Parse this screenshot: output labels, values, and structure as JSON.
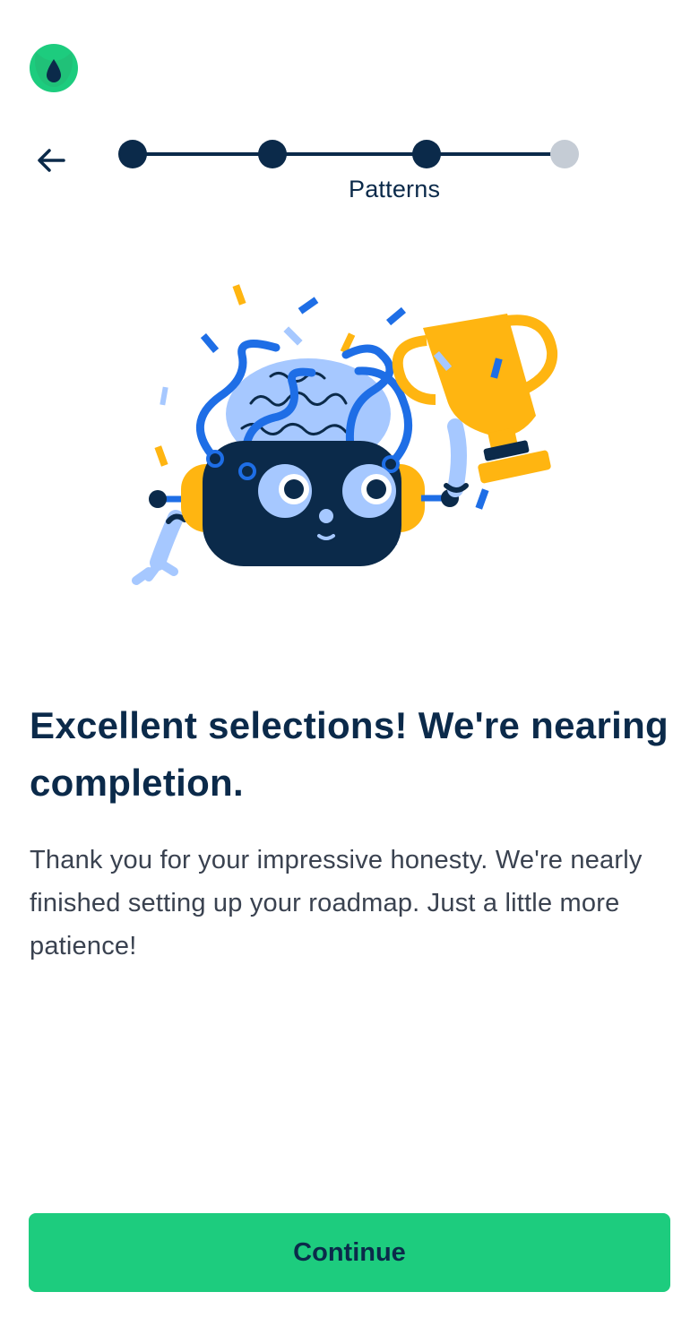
{
  "app": {
    "logo_icon": "app-logo-icon",
    "brand_color": "#1dcc7e"
  },
  "navigation": {
    "back_icon": "arrow-left-icon"
  },
  "progress": {
    "total_steps": 4,
    "completed_steps": 3,
    "current_step_label": "Patterns",
    "active_color": "#0b2a4a",
    "pending_color": "#c5ccd5"
  },
  "illustration": {
    "icon": "robot-brain-trophy-illustration"
  },
  "content": {
    "headline": "Excellent selections! We're nearing completion.",
    "body": "Thank you for your impressive honesty. We're nearly finished setting up your roadmap. Just a little more patience!"
  },
  "footer": {
    "continue_label": "Continue",
    "button_color": "#1dcc7e"
  }
}
